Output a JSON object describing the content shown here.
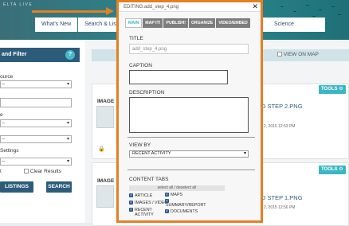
{
  "app": {
    "brand": "ELTA LIVE"
  },
  "nav": {
    "tabs": [
      {
        "label": "What's New"
      },
      {
        "label": "Search & List V"
      }
    ],
    "science": "Science"
  },
  "left_panel": {
    "header": "and Filter",
    "help_icon": "?",
    "labels": [
      "ource",
      "e",
      "",
      "Settings"
    ],
    "select_placeholder": "--",
    "checkbox_label_1": "t",
    "clear_results_label": "Clear Results",
    "listings_button": "LISTINGS",
    "search_button": "SEARCH"
  },
  "content": {
    "view_on_map": "VIEW ON MAP",
    "cards": [
      {
        "type_label": "IMAGE",
        "tools_label": "TOOLS",
        "title": "D STEP 2.PNG",
        "date": "2, 2015 12:53 PM"
      },
      {
        "type_label": "IMAGE",
        "tools_label": "TOOLS",
        "title": "D STEP 1.PNG",
        "date": "2, 2015 12:56 PM"
      }
    ]
  },
  "modal": {
    "title": "EDITING:add_step_4.png",
    "close_icon": "✕",
    "tabs": [
      {
        "label": "MAIN",
        "active": true
      },
      {
        "label": "MAP IT!",
        "active": false
      },
      {
        "label": "PUBLISH!",
        "active": false
      },
      {
        "label": "ORGANIZE",
        "active": false
      },
      {
        "label": "VIDEO/EMBED",
        "active": false
      }
    ],
    "title_label": "TITLE",
    "title_value": "add_step_4.png",
    "caption_label": "CAPTION",
    "description_label": "DESCRIPTION",
    "view_by_label": "VIEW BY",
    "view_by_value": "RECENT ACTIVITY",
    "content_tabs_label": "CONTENT TABS",
    "select_all": "select all / deselect all",
    "content_tabs": [
      {
        "label": "ARTICLE",
        "checked": true
      },
      {
        "label": "MAPS",
        "checked": true
      },
      {
        "label": "IMAGES / VIDEO",
        "checked": true
      },
      {
        "label": "SUMMARY/REPORT",
        "checked": true
      },
      {
        "label": "RECENT ACTIVITY",
        "checked": true
      },
      {
        "label": "DOCUMENTS",
        "checked": true
      }
    ]
  },
  "colors": {
    "accent_orange": "#e67e22",
    "header_blue": "#2d5c7a",
    "tools_teal": "#3bb7c4"
  }
}
